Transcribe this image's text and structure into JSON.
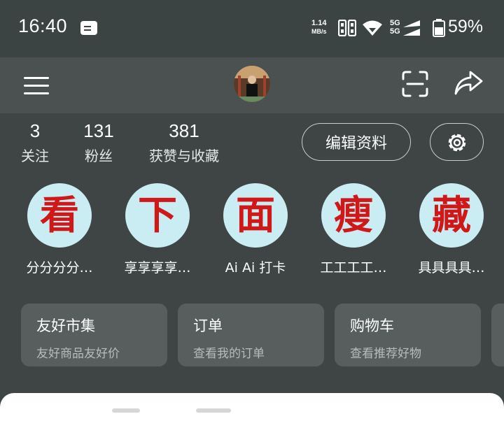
{
  "status": {
    "time": "16:40",
    "net_speed_value": "1.14",
    "net_speed_unit": "MB/s",
    "network_1": "5G",
    "network_2": "5G",
    "battery": "59%",
    "icons": [
      "message-icon",
      "sim-icon",
      "wifi-icon",
      "signal-icon",
      "battery-icon"
    ]
  },
  "header": {
    "icons": [
      "menu-icon",
      "avatar",
      "scan-icon",
      "share-icon"
    ]
  },
  "stats": [
    {
      "value": "3",
      "label": "关注"
    },
    {
      "value": "131",
      "label": "粉丝"
    },
    {
      "value": "381",
      "label": "获赞与收藏"
    }
  ],
  "profile_actions": {
    "edit_label": "编辑资料",
    "settings_icon": "gear-icon"
  },
  "collections": [
    {
      "char": "看",
      "label": "分分分分…"
    },
    {
      "char": "下",
      "label": "享享享享…"
    },
    {
      "char": "面",
      "label": "Ai Ai 打卡"
    },
    {
      "char": "瘦",
      "label": "工工工工…"
    },
    {
      "char": "藏",
      "label": "具具具具…"
    }
  ],
  "cards": [
    {
      "title": "友好市集",
      "subtitle": "友好商品友好价"
    },
    {
      "title": "订单",
      "subtitle": "查看我的订单"
    },
    {
      "title": "购物车",
      "subtitle": "查看推荐好物"
    }
  ],
  "colors": {
    "background": "#3e4544",
    "header": "#4a5150",
    "circle_bg": "#c9edf2",
    "circle_char": "#d01818",
    "card_bg": "#575e5d"
  }
}
